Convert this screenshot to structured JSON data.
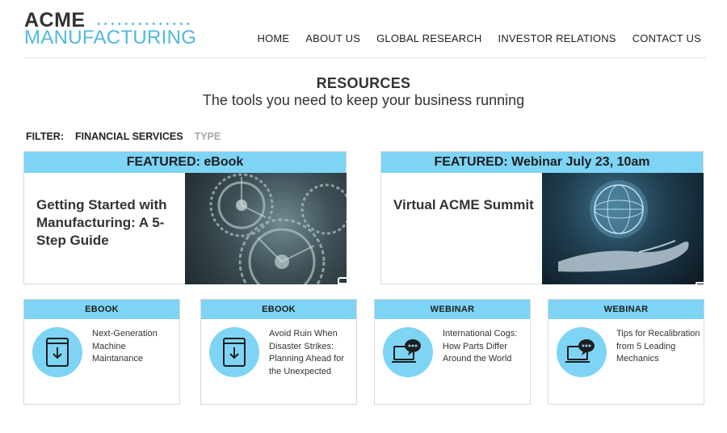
{
  "brand": {
    "line1": "ACME",
    "line2": "MANUFACTURING"
  },
  "nav": [
    {
      "label": "HOME"
    },
    {
      "label": "ABOUT US"
    },
    {
      "label": "GLOBAL RESEARCH"
    },
    {
      "label": "INVESTOR RELATIONS"
    },
    {
      "label": "CONTACT US"
    }
  ],
  "page": {
    "title": "RESOURCES",
    "subtitle": "The tools you need to keep your business running"
  },
  "filter": {
    "label": "FILTER:",
    "options": [
      "FINANCIAL SERVICES",
      "TYPE"
    ]
  },
  "featured": [
    {
      "band": "FEATURED: eBook",
      "title": "Getting Started with Manufacturing: A 5-Step Guide",
      "icon": "ebook-download-icon"
    },
    {
      "band": "FEATURED: Webinar July 23, 10am",
      "title": "Virtual ACME Summit",
      "icon": "webinar-chat-icon"
    }
  ],
  "cards": [
    {
      "type": "EBOOK",
      "text": "Next-Generation Machine Maintanance",
      "icon": "ebook-download-icon"
    },
    {
      "type": "EBOOK",
      "text": "Avoid Ruin When Disaster Strikes: Planning Ahead for the Unexpected",
      "icon": "ebook-download-icon"
    },
    {
      "type": "WEBINAR",
      "text": "International Cogs: How Parts Differ Around the World",
      "icon": "webinar-chat-icon"
    },
    {
      "type": "WEBINAR",
      "text": "Tips for Recalibration from 5 Leading Mechanics",
      "icon": "webinar-chat-icon"
    }
  ],
  "colors": {
    "accent": "#7dd4f5",
    "brand_blue": "#4fb8e3",
    "text": "#333333"
  }
}
